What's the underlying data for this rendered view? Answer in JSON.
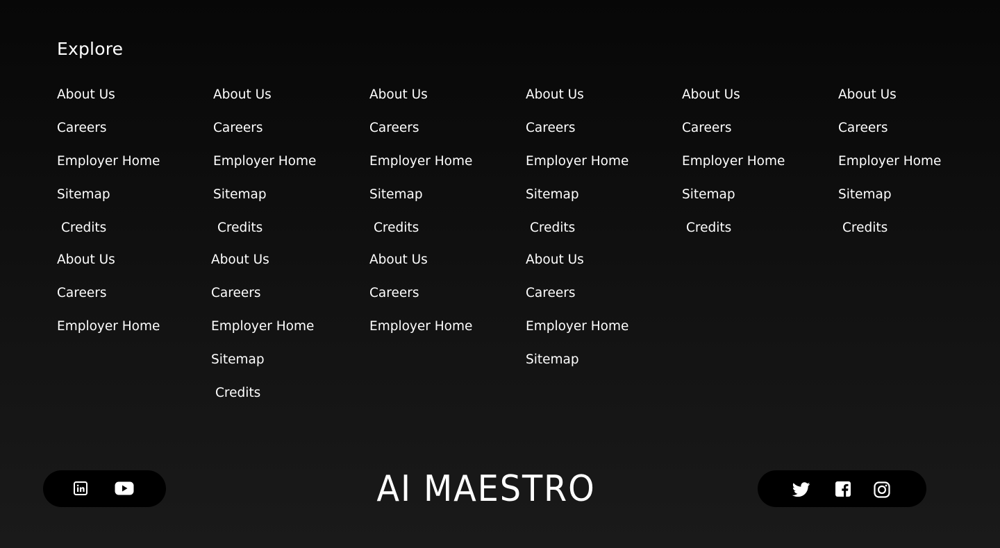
{
  "footer": {
    "explore_title": "Explore",
    "columns_top": [
      {
        "links": [
          "About Us",
          "Careers",
          "Employer Home",
          "Sitemap",
          "Credits"
        ]
      },
      {
        "links": [
          "About Us",
          "Careers",
          "Employer Home",
          "Sitemap",
          "Credits"
        ]
      },
      {
        "links": [
          "About Us",
          "Careers",
          "Employer Home",
          "Sitemap",
          "Credits"
        ]
      },
      {
        "links": [
          "About Us",
          "Careers",
          "Employer Home",
          "Sitemap",
          "Credits"
        ]
      },
      {
        "links": [
          "About Us",
          "Careers",
          "Employer Home",
          "Sitemap",
          "Credits"
        ]
      },
      {
        "links": [
          "About Us",
          "Careers",
          "Employer Home",
          "Sitemap",
          "Credits"
        ]
      }
    ],
    "columns_bottom": [
      {
        "links": [
          "About Us",
          "Careers",
          "Employer Home"
        ]
      },
      {
        "links": [
          "About Us",
          "Careers",
          "Employer Home",
          "Sitemap",
          "Credits"
        ]
      },
      {
        "links": [
          "About Us",
          "Careers",
          "Employer Home"
        ]
      },
      {
        "links": [
          "About Us",
          "Careers",
          "Employer Home",
          "Sitemap"
        ]
      }
    ],
    "brand": "AI MAESTRO",
    "social_left": [
      {
        "icon": "linkedin-icon"
      },
      {
        "icon": "youtube-icon"
      }
    ],
    "social_right": [
      {
        "icon": "twitter-icon"
      },
      {
        "icon": "facebook-icon"
      },
      {
        "icon": "instagram-icon"
      }
    ],
    "colors": {
      "background_top": "#070707",
      "background_bottom": "#1a1a1a",
      "text": "#ffffff",
      "pill": "#000000"
    }
  }
}
